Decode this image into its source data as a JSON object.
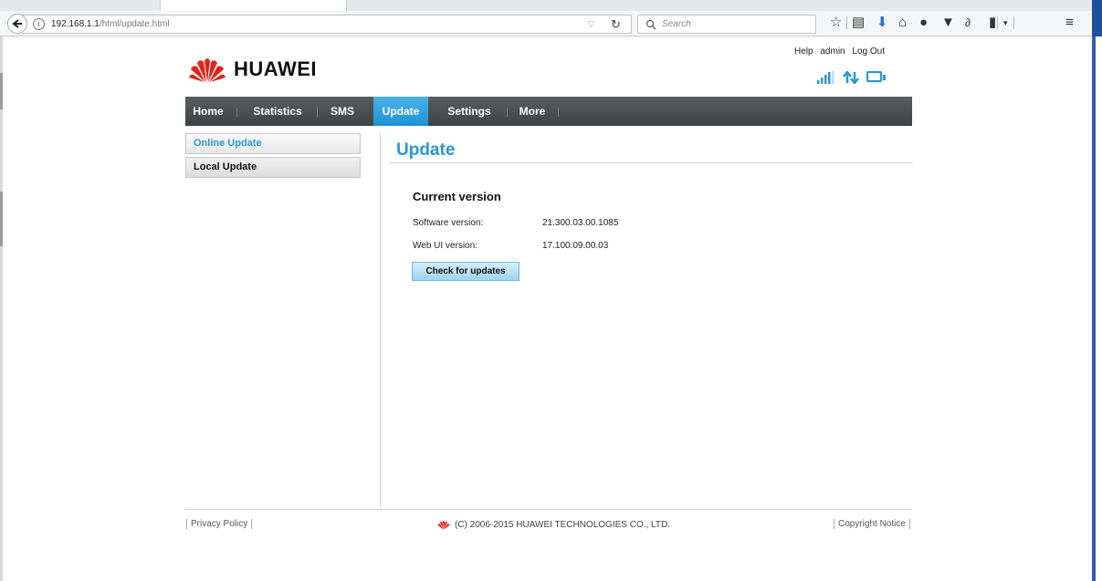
{
  "browser": {
    "url_host": "192.168.1.1",
    "url_path": "/html/update.html",
    "search_placeholder": "Search"
  },
  "brand": {
    "name": "HUAWEI"
  },
  "top_links": {
    "help": "Help",
    "user": "admin",
    "logout": "Log Out"
  },
  "nav": {
    "items": [
      {
        "label": "Home",
        "active": false
      },
      {
        "label": "Statistics",
        "active": false
      },
      {
        "label": "SMS",
        "active": false
      },
      {
        "label": "Update",
        "active": true
      },
      {
        "label": "Settings",
        "active": false
      },
      {
        "label": "More",
        "active": false
      }
    ]
  },
  "sidebar": {
    "items": [
      {
        "label": "Online Update",
        "selected": true
      },
      {
        "label": "Local Update",
        "selected": false
      }
    ]
  },
  "main": {
    "title": "Update",
    "section_title": "Current version",
    "fields": [
      {
        "label": "Software version:",
        "value": "21.300.03.00.1085"
      },
      {
        "label": "Web UI version:",
        "value": "17.100.09.00.03"
      }
    ],
    "check_button": "Check for updates"
  },
  "footer": {
    "privacy": "Privacy Policy",
    "copyright": "(C) 2006-2015 HUAWEI TECHNOLOGIES CO., LTD.",
    "notice": "Copyright Notice"
  },
  "colors": {
    "accent": "#2a96d8",
    "nav_bg": "#4a4d4f",
    "brand_red": "#e2231a"
  }
}
